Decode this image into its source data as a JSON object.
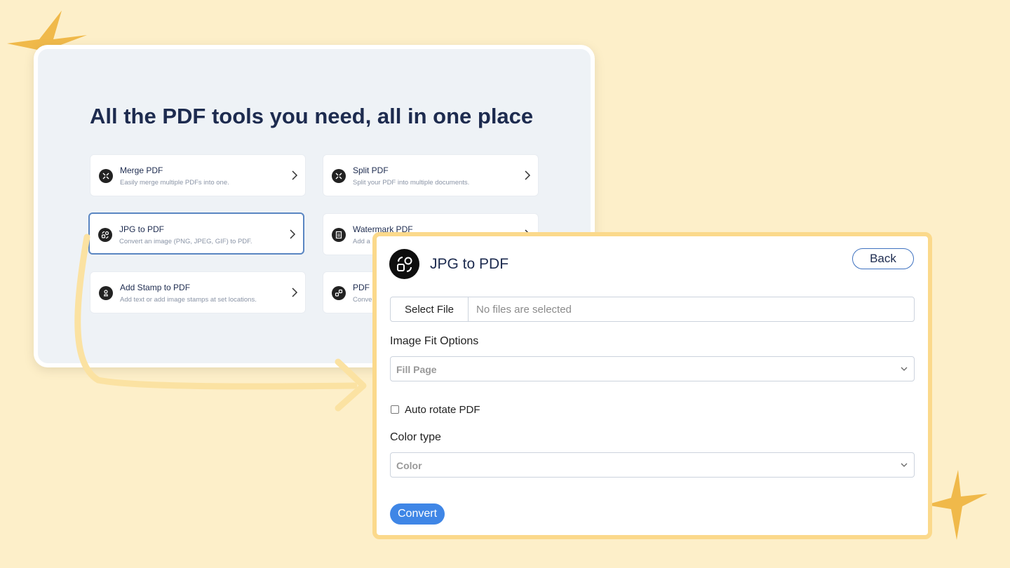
{
  "colors": {
    "background": "#fdefc9",
    "accent": "#3f86e6",
    "dialog_border": "#fbd98b",
    "selected_border": "#5a86c2"
  },
  "tools_panel": {
    "title": "All the PDF tools you need, all in one place",
    "tools": [
      {
        "name": "Merge PDF",
        "description": "Easily merge multiple PDFs into one.",
        "icon": "merge-icon"
      },
      {
        "name": "Split PDF",
        "description": "Split your PDF into multiple documents.",
        "icon": "split-icon"
      },
      {
        "name": "JPG to PDF",
        "description": "Convert an image (PNG, JPEG, GIF) to PDF.",
        "icon": "image-convert-icon",
        "selected": true
      },
      {
        "name": "Watermark PDF",
        "description": "Add a",
        "icon": "watermark-icon"
      },
      {
        "name": "Add Stamp to PDF",
        "description": "Add text or add image stamps at set locations.",
        "icon": "stamp-icon"
      },
      {
        "name": "PDF",
        "description": "Conve",
        "icon": "convert-icon"
      }
    ]
  },
  "dialog": {
    "title": "JPG to PDF",
    "logo_icon": "image-convert-icon",
    "back_label": "Back",
    "file_picker": {
      "button_label": "Select File",
      "status": "No files are selected"
    },
    "image_fit": {
      "label": "Image Fit Options",
      "selected": "Fill Page"
    },
    "auto_rotate": {
      "label": "Auto rotate PDF",
      "checked": false
    },
    "color_type": {
      "label": "Color type",
      "selected": "Color"
    },
    "convert_label": "Convert"
  }
}
